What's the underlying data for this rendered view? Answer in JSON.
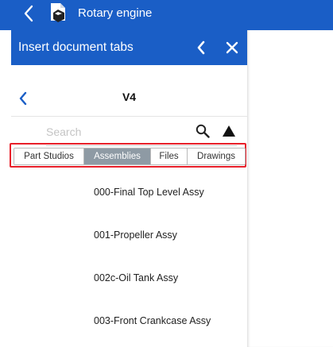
{
  "topbar": {
    "title": "Rotary engine",
    "icons": [
      "back-chevron-icon",
      "document-icon"
    ]
  },
  "panel": {
    "title": "Insert document tabs",
    "icons": [
      "back-chevron-icon",
      "close-icon"
    ]
  },
  "version": {
    "label": "V4"
  },
  "search": {
    "placeholder": "Search",
    "value": ""
  },
  "tabs": [
    {
      "label": "Part Studios",
      "selected": false
    },
    {
      "label": "Assemblies",
      "selected": true
    },
    {
      "label": "Files",
      "selected": false
    },
    {
      "label": "Drawings",
      "selected": false
    }
  ],
  "items": [
    {
      "label": "000-Final Top Level Assy"
    },
    {
      "label": "001-Propeller Assy"
    },
    {
      "label": "002c-Oil Tank Assy"
    },
    {
      "label": "003-Front Crankcase Assy"
    }
  ],
  "colors": {
    "brand": "#1a5ec6",
    "selected_tab": "#8e9aa4",
    "highlight": "#e8202a"
  }
}
